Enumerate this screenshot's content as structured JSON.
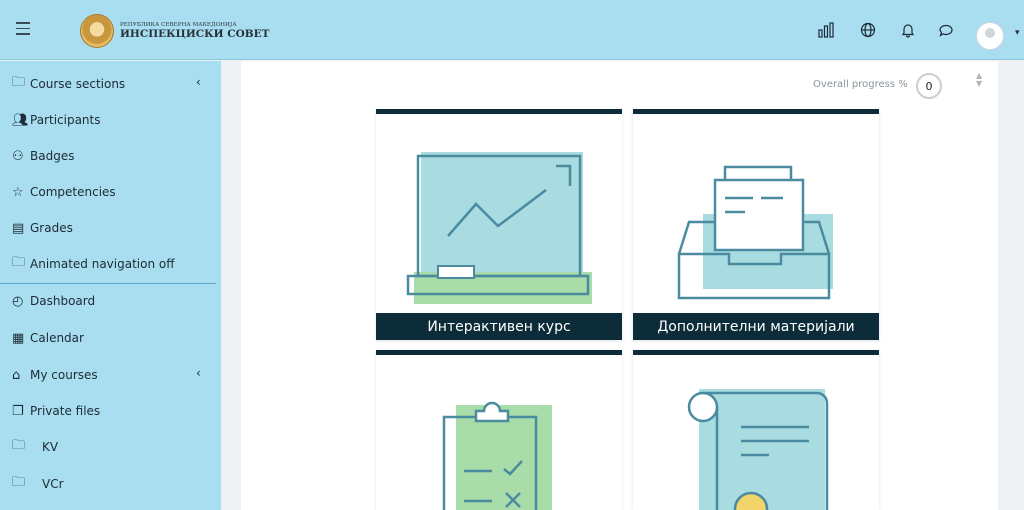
{
  "header": {
    "brand_line1": "РЕПУБЛИКА СЕВЕРНА МАКЕДОНИЈА",
    "brand_line2": "ИНСПЕКЦИСКИ СОВЕТ",
    "icons": [
      "menu-icon",
      "chart-icon",
      "globe-icon",
      "bell-icon",
      "chat-icon",
      "user-avatar"
    ]
  },
  "sidebar": {
    "items": [
      {
        "label": "Course sections",
        "icon": "folder-icon"
      },
      {
        "label": "Participants",
        "icon": "users-icon"
      },
      {
        "label": "Badges",
        "icon": "badge-icon"
      },
      {
        "label": "Competencies",
        "icon": "star-icon"
      },
      {
        "label": "Grades",
        "icon": "grades-icon"
      },
      {
        "label": "Animated navigation off",
        "icon": "folder-icon"
      },
      {
        "label": "Dashboard",
        "icon": "dashboard-icon"
      },
      {
        "label": "Calendar",
        "icon": "calendar-icon"
      },
      {
        "label": "My courses",
        "icon": "graduation-cap-icon"
      },
      {
        "label": "Private files",
        "icon": "files-icon"
      },
      {
        "label": "KV",
        "icon": "folder-icon"
      },
      {
        "label": "VCr",
        "icon": "folder-icon"
      }
    ]
  },
  "main": {
    "progress_label": "Overall progress %",
    "progress_value": "0",
    "tiles": [
      {
        "caption": "Интерактивен курс"
      },
      {
        "caption": "Дополнителни материјали"
      },
      {
        "caption": ""
      },
      {
        "caption": ""
      }
    ]
  },
  "colors": {
    "accent": "#a9ddf0",
    "dark": "#0c2c3a",
    "illustration_teal": "#a8dce0",
    "illustration_green": "#a8dca8",
    "line": "#4a8ba0"
  }
}
